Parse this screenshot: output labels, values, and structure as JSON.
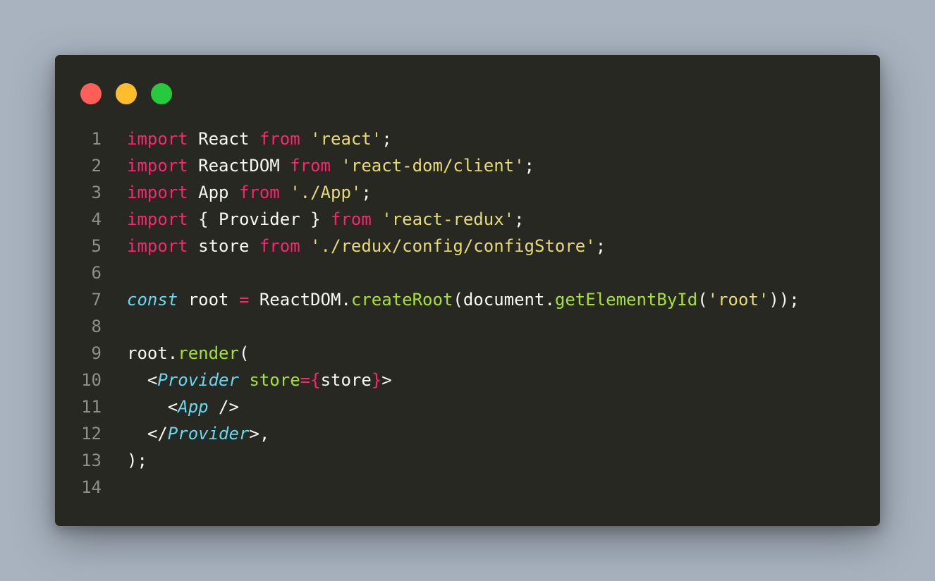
{
  "window": {
    "controls": [
      "close",
      "minimize",
      "maximize"
    ],
    "colors": {
      "background": "#272822",
      "close": "#ff5f56",
      "minimize": "#ffbd2e",
      "maximize": "#27c93f"
    }
  },
  "code": {
    "language": "javascript",
    "lines": [
      {
        "n": "1",
        "tokens": [
          [
            "kw",
            "import"
          ],
          [
            "pl",
            " React "
          ],
          [
            "kw",
            "from"
          ],
          [
            "pl",
            " "
          ],
          [
            "str",
            "'react'"
          ],
          [
            "pl",
            ";"
          ]
        ]
      },
      {
        "n": "2",
        "tokens": [
          [
            "kw",
            "import"
          ],
          [
            "pl",
            " ReactDOM "
          ],
          [
            "kw",
            "from"
          ],
          [
            "pl",
            " "
          ],
          [
            "str",
            "'react-dom/client'"
          ],
          [
            "pl",
            ";"
          ]
        ]
      },
      {
        "n": "3",
        "tokens": [
          [
            "kw",
            "import"
          ],
          [
            "pl",
            " App "
          ],
          [
            "kw",
            "from"
          ],
          [
            "pl",
            " "
          ],
          [
            "str",
            "'./App'"
          ],
          [
            "pl",
            ";"
          ]
        ]
      },
      {
        "n": "4",
        "tokens": [
          [
            "kw",
            "import"
          ],
          [
            "pl",
            " { Provider } "
          ],
          [
            "kw",
            "from"
          ],
          [
            "pl",
            " "
          ],
          [
            "str",
            "'react-redux'"
          ],
          [
            "pl",
            ";"
          ]
        ]
      },
      {
        "n": "5",
        "tokens": [
          [
            "kw",
            "import"
          ],
          [
            "pl",
            " store "
          ],
          [
            "kw",
            "from"
          ],
          [
            "pl",
            " "
          ],
          [
            "str",
            "'./redux/config/configStore'"
          ],
          [
            "pl",
            ";"
          ]
        ]
      },
      {
        "n": "6",
        "tokens": []
      },
      {
        "n": "7",
        "tokens": [
          [
            "st",
            "const"
          ],
          [
            "pl",
            " root "
          ],
          [
            "op",
            "="
          ],
          [
            "pl",
            " ReactDOM."
          ],
          [
            "fn",
            "createRoot"
          ],
          [
            "pl",
            "(document."
          ],
          [
            "fn",
            "getElementById"
          ],
          [
            "pl",
            "("
          ],
          [
            "str",
            "'root'"
          ],
          [
            "pl",
            "));"
          ]
        ]
      },
      {
        "n": "8",
        "tokens": []
      },
      {
        "n": "9",
        "tokens": [
          [
            "pl",
            "root."
          ],
          [
            "fn",
            "render"
          ],
          [
            "pl",
            "("
          ]
        ]
      },
      {
        "n": "10",
        "tokens": [
          [
            "pl",
            "  <"
          ],
          [
            "comp",
            "Provider"
          ],
          [
            "pl",
            " "
          ],
          [
            "attr",
            "store"
          ],
          [
            "op",
            "={"
          ],
          [
            "pl",
            "store"
          ],
          [
            "op",
            "}"
          ],
          [
            "pl",
            ">"
          ]
        ]
      },
      {
        "n": "11",
        "tokens": [
          [
            "pl",
            "    <"
          ],
          [
            "comp",
            "App"
          ],
          [
            "pl",
            " />"
          ]
        ]
      },
      {
        "n": "12",
        "tokens": [
          [
            "pl",
            "  </"
          ],
          [
            "comp",
            "Provider"
          ],
          [
            "pl",
            ">,"
          ]
        ]
      },
      {
        "n": "13",
        "tokens": [
          [
            "pl",
            ");"
          ]
        ]
      },
      {
        "n": "14",
        "tokens": []
      }
    ]
  }
}
